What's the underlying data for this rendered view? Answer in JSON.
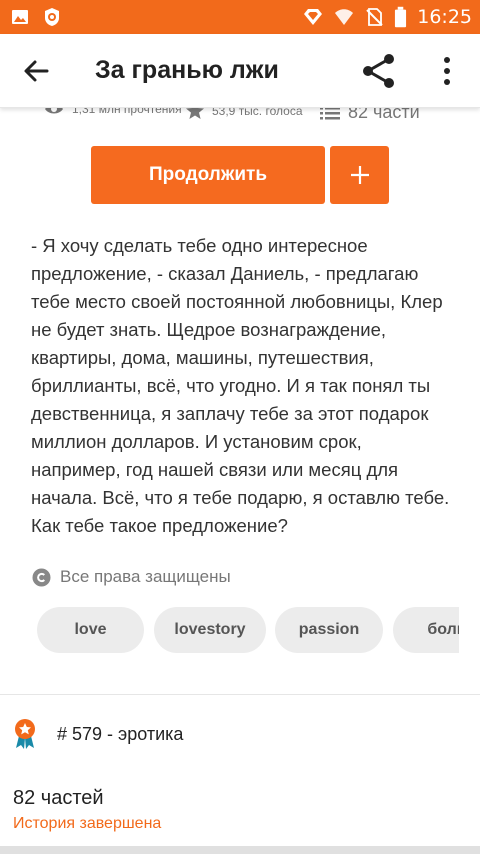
{
  "status_bar": {
    "time": "16:25",
    "icons": [
      "image-icon",
      "app-icon",
      "vibrate-icon",
      "wifi-icon",
      "no-sim-icon",
      "battery-icon"
    ]
  },
  "app_bar": {
    "title": "За гранью лжи",
    "icons": [
      "back-arrow-icon",
      "share-icon",
      "more-vert-icon"
    ]
  },
  "stats": {
    "reads": "1,31 млн прочтения",
    "votes": "53,9 тыс. голоса",
    "parts": "82 части"
  },
  "actions": {
    "continue_label": "Продолжить",
    "add_symbol": "+"
  },
  "description": "- Я хочу сделать тебе одно интересное предложение, - сказал Даниель, - предлагаю тебе место своей постоянной любовницы, Клер не будет знать. Щедрое вознаграждение, квартиры, дома, машины, путешествия, бриллианты, всё, что угодно. И я так понял ты девственница, я заплачу тебе за этот подарок миллион долларов. И установим срок, например, год нашей связи или месяц для начала. Всё, что я тебе подарю, я оставлю тебе. Как тебе такое предложение?",
  "rights": "Все права защищены",
  "tags": [
    "love",
    "lovestory",
    "passion",
    "боль"
  ],
  "rank": "# 579 - эротика",
  "parts_count": "82 частей",
  "story_status": "История завершена",
  "colors": {
    "accent": "#f26a1b",
    "button": "#f56a1f",
    "tag_bg": "#ececec"
  }
}
